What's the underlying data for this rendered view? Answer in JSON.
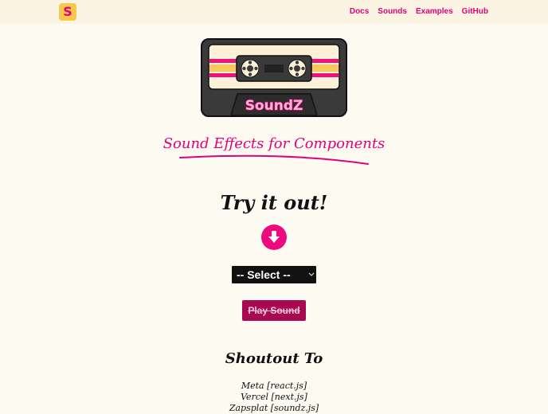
{
  "nav": {
    "logo_letter": "S",
    "links": [
      "Docs",
      "Sounds",
      "Examples",
      "GitHub"
    ]
  },
  "hero": {
    "brand": "SoundZ",
    "tagline": "Sound Effects for Components"
  },
  "demo": {
    "title": "Try it out!",
    "arrow_icon": "arrow-down-circle-icon",
    "select_value": "-- Select --",
    "play_label": "Play Sound"
  },
  "shoutout": {
    "title": "Shoutout To",
    "items": [
      "Meta [react.js]",
      "Vercel [next.js]",
      "Zapsplat [soundz.js]"
    ]
  },
  "colors": {
    "accent": "#e3007a",
    "background": "#fdfbf1",
    "nav_background": "#fcf4e2",
    "cassette_body": "#3a3a3a",
    "label_cream": "#fdf1d8",
    "stripe_yellow": "#f9c95a",
    "play_button": "#a70a50"
  }
}
